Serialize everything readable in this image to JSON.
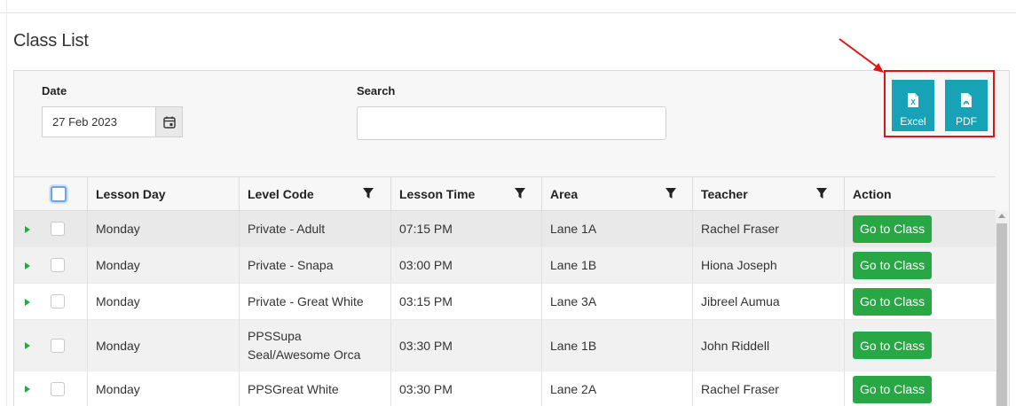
{
  "page": {
    "title": "Class List"
  },
  "filters": {
    "date_label": "Date",
    "date_value": "27 Feb 2023",
    "search_label": "Search",
    "search_value": ""
  },
  "export": {
    "excel_label": "Excel",
    "pdf_label": "PDF",
    "accent_color": "#17a2b8",
    "highlight_color": "#e11414"
  },
  "table": {
    "columns": [
      "Lesson Day",
      "Level Code",
      "Lesson Time",
      "Area",
      "Teacher",
      "Action"
    ],
    "rows": [
      {
        "day": "Monday",
        "level": "Private - Adult",
        "time": "07:15 PM",
        "area": "Lane 1A",
        "teacher": "Rachel Fraser",
        "action": "Go to Class"
      },
      {
        "day": "Monday",
        "level": "Private - Snapa",
        "time": "03:00 PM",
        "area": "Lane 1B",
        "teacher": "Hiona Joseph",
        "action": "Go to Class"
      },
      {
        "day": "Monday",
        "level": "Private - Great White",
        "time": "03:15 PM",
        "area": "Lane 3A",
        "teacher": "Jibreel Aumua",
        "action": "Go to Class"
      },
      {
        "day": "Monday",
        "level_line1": "PPSSupa",
        "level_line2": "Seal/Awesome Orca",
        "time": "03:30 PM",
        "area": "Lane 1B",
        "teacher": "John Riddell",
        "action": "Go to Class"
      },
      {
        "day": "Monday",
        "level": "PPSGreat White",
        "time": "03:30 PM",
        "area": "Lane 2A",
        "teacher": "Rachel Fraser",
        "action": "Go to Class"
      }
    ],
    "action_color": "#28a745"
  }
}
